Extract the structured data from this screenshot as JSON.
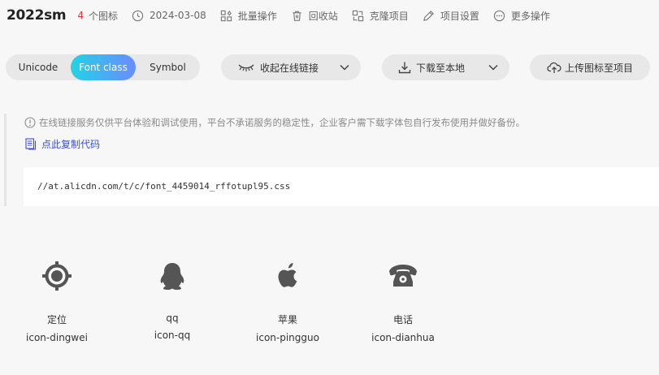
{
  "header": {
    "title": "2022sm",
    "icon_count": "4",
    "icon_count_label": "个图标",
    "date": "2024-03-08",
    "batch_ops": "批量操作",
    "recycle_bin": "回收站",
    "clone_project": "克隆项目",
    "project_settings": "项目设置",
    "more_ops": "更多操作"
  },
  "toolbar": {
    "tabs": [
      "Unicode",
      "Font class",
      "Symbol"
    ],
    "active_tab": "Font class",
    "collapse_link": "收起在线链接",
    "download": "下载至本地",
    "upload": "上传图标至项目"
  },
  "notice": {
    "text": "在线链接服务仅供平台体验和调试使用，平台不承诺服务的稳定性，企业客户需下载字体包自行发布使用并做好备份。",
    "copy_code": "点此复制代码",
    "css_url": "//at.alicdn.com/t/c/font_4459014_rffotupl95.css"
  },
  "icons": [
    {
      "name": "定位",
      "class": "icon-dingwei",
      "glyph": "location-icon"
    },
    {
      "name": "qq",
      "class": "icon-qq",
      "glyph": "qq-icon"
    },
    {
      "name": "苹果",
      "class": "icon-pingguo",
      "glyph": "apple-icon"
    },
    {
      "name": "电话",
      "class": "icon-dianhua",
      "glyph": "telephone-icon"
    }
  ],
  "colors": {
    "count": "#e53935",
    "active_tab_gradient_start": "#22d3e6",
    "active_tab_gradient_end": "#6a8cff",
    "link": "#3b4fd8",
    "icon_fill": "#555555"
  }
}
